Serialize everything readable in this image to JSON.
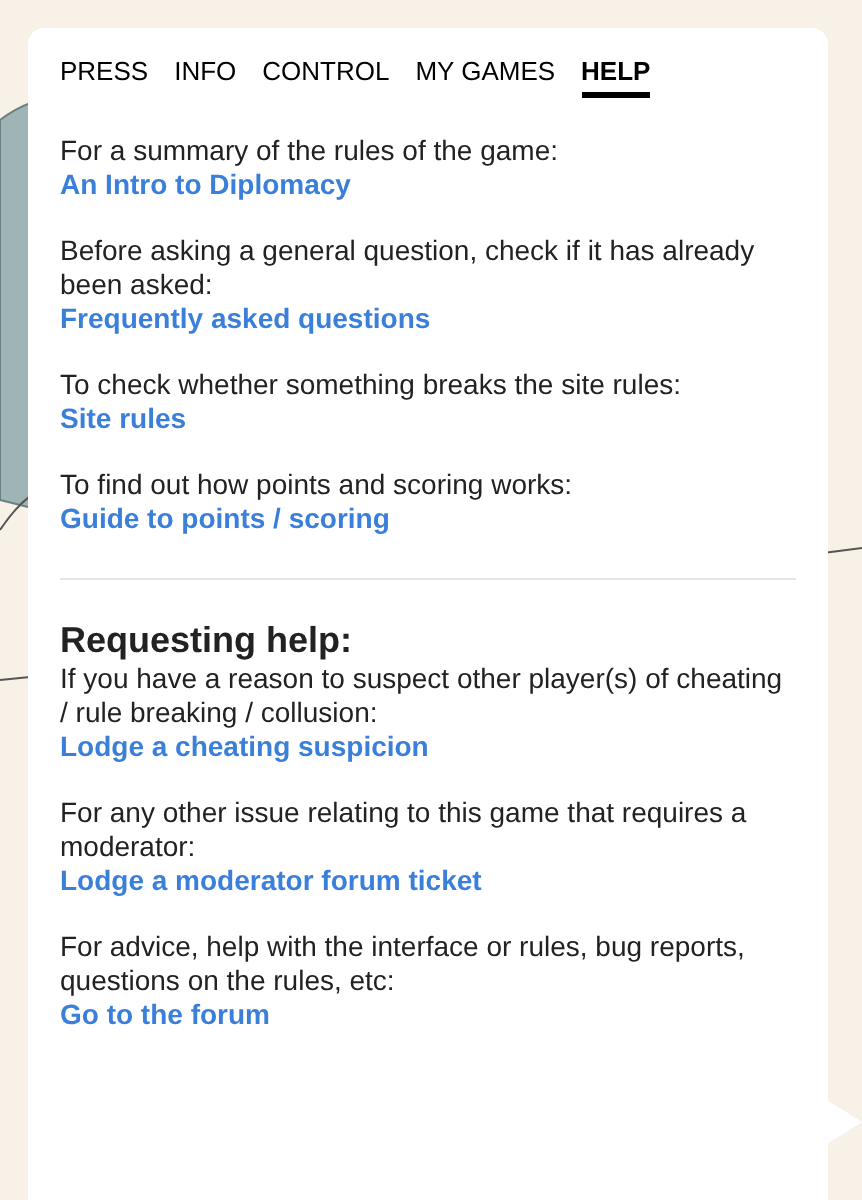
{
  "tabs": [
    {
      "label": "PRESS",
      "selected": false
    },
    {
      "label": "INFO",
      "selected": false
    },
    {
      "label": "CONTROL",
      "selected": false
    },
    {
      "label": "MY GAMES",
      "selected": false
    },
    {
      "label": "HELP",
      "selected": true
    }
  ],
  "sections": [
    {
      "items": [
        {
          "text": "For a summary of the rules of the game:",
          "link": "An Intro to Diplomacy"
        },
        {
          "text": "Before asking a general question, check if it has already been asked:",
          "link": "Frequently asked questions"
        },
        {
          "text": "To check whether something breaks the site rules:",
          "link": "Site rules"
        },
        {
          "text": "To find out how points and scoring works:",
          "link": "Guide to points / scoring"
        }
      ]
    },
    {
      "heading": "Requesting help:",
      "items": [
        {
          "text": "If you have a reason to suspect other player(s) of cheating / rule breaking / collusion:",
          "link": "Lodge a cheating suspicion"
        },
        {
          "text": "For any other issue relating to this game that requires a moderator:",
          "link": "Lodge a moderator forum ticket"
        },
        {
          "text": "For advice, help with the interface or rules, bug reports, questions on the rules, etc:",
          "link": "Go to the forum"
        }
      ]
    }
  ]
}
